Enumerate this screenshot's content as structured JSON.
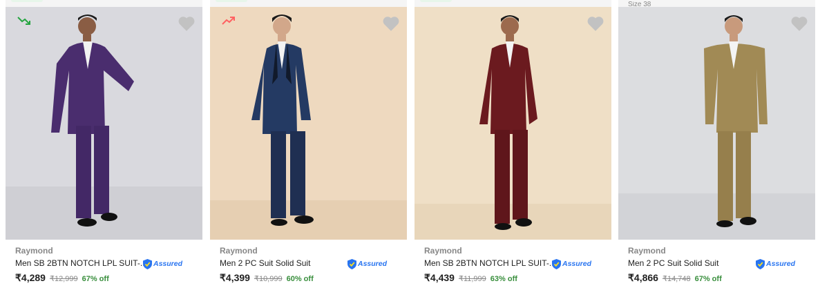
{
  "products": [
    {
      "brand": "Raymond",
      "title": "Men SB 2BTN NOTCH LPL SUIT-...",
      "assured_label": "Assured",
      "price": "₹4,289",
      "mrp": "₹12,999",
      "discount": "67% off",
      "trend": "down",
      "trend_color": "#26a541",
      "bg_color": "#d9d9de",
      "suit_color": "#4a2d6e"
    },
    {
      "brand": "Raymond",
      "title": "Men 2 PC Suit Solid Suit",
      "assured_label": "Assured",
      "price": "₹4,399",
      "mrp": "₹10,999",
      "discount": "60% off",
      "trend": "up",
      "trend_color": "#ff6161",
      "bg_color": "#eed9bf",
      "suit_color": "#243a63"
    },
    {
      "brand": "Raymond",
      "title": "Men SB 2BTN NOTCH LPL SUIT-...",
      "assured_label": "Assured",
      "price": "₹4,439",
      "mrp": "₹11,999",
      "discount": "63% off",
      "trend": "none",
      "bg_color": "#efdfc6",
      "suit_color": "#6b1a1f"
    },
    {
      "brand": "Raymond",
      "title": "Men 2 PC Suit Solid Suit",
      "assured_label": "Assured",
      "price": "₹4,866",
      "mrp": "₹14,748",
      "discount": "67% off",
      "trend": "none",
      "bg_color": "#dcdde0",
      "suit_color": "#a18a55"
    }
  ],
  "icons": {
    "heart": "heart-icon",
    "trend_down": "trending-down-icon",
    "trend_up": "trending-up-icon",
    "assured": "assured-shield-icon"
  },
  "colors": {
    "heart": "#c2c2c2",
    "price_green": "#388e3c",
    "assured_blue": "#2874f0"
  },
  "top_hint": "Size 38"
}
